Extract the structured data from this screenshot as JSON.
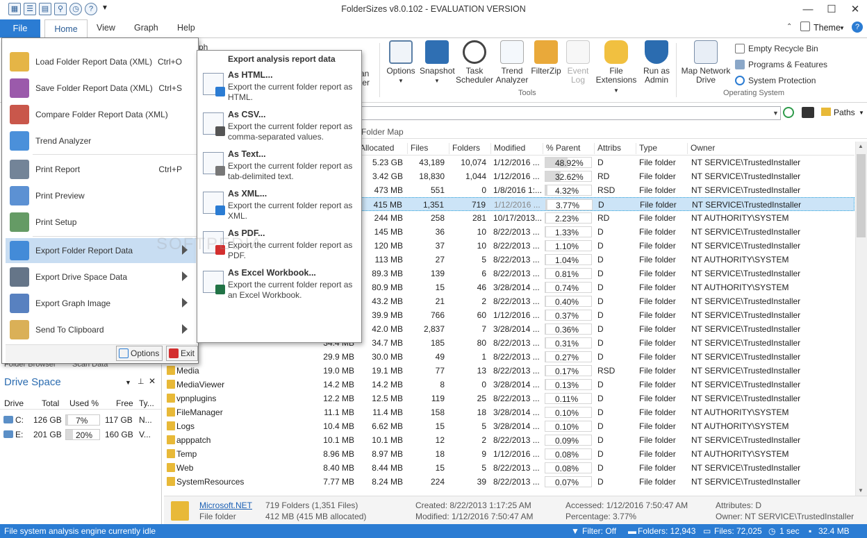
{
  "window": {
    "title": "FolderSizes v8.0.102 - EVALUATION VERSION",
    "minimize": "—",
    "maximize": "☐",
    "close": "✕"
  },
  "qat_icons": [
    "save-icon",
    "report-icon",
    "grid-icon",
    "filter-icon",
    "clock-icon",
    "help-icon"
  ],
  "tabs": {
    "file": "File",
    "home": "Home",
    "view": "View",
    "graph": "Graph",
    "help": "Help",
    "theme": "Theme"
  },
  "ribbon": {
    "partial_view": "ph",
    "partial_filter_a": "an",
    "partial_filter_b": "ter",
    "options": "Options",
    "snapshot": "Snapshot",
    "task_scheduler_1": "Task",
    "task_scheduler_2": "Scheduler",
    "trend_1": "Trend",
    "trend_2": "Analyzer",
    "filterzip": "FilterZip",
    "event_1": "Event",
    "event_2": "Log",
    "file_ext_1": "File",
    "file_ext_2": "Extensions",
    "run_admin_1": "Run as",
    "run_admin_2": "Admin",
    "tools_group": "Tools",
    "map_network_1": "Map Network",
    "map_network_2": "Drive",
    "empty_recycle": "Empty Recycle Bin",
    "programs": "Programs & Features",
    "system_protection": "System Protection",
    "os_group": "Operating System"
  },
  "pathbar": {
    "paths_label": "Paths"
  },
  "view_tabs": {
    "folder_map": "Folder Map"
  },
  "columns": [
    "Allocated",
    "Files",
    "Folders",
    "Modified",
    "% Parent",
    "Attribs",
    "Type",
    "Owner"
  ],
  "rows": [
    {
      "name": "",
      "size": "",
      "alloc": "5.23 GB",
      "files": "43,189",
      "folders": "10,074",
      "mod": "1/12/2016 ...",
      "pct": "48.92%",
      "pctv": 48.92,
      "attr": "D",
      "type": "File folder",
      "owner": "NT SERVICE\\TrustedInstaller"
    },
    {
      "name": "",
      "size": "",
      "alloc": "3.42 GB",
      "files": "18,830",
      "folders": "1,044",
      "mod": "1/12/2016 ...",
      "pct": "32.62%",
      "pctv": 32.62,
      "attr": "RD",
      "type": "File folder",
      "owner": "NT SERVICE\\TrustedInstaller"
    },
    {
      "name": "",
      "size": "",
      "alloc": "473 MB",
      "files": "551",
      "folders": "0",
      "mod": "1/8/2016 1:...",
      "pct": "4.32%",
      "pctv": 4.32,
      "attr": "RSD",
      "type": "File folder",
      "owner": "NT SERVICE\\TrustedInstaller"
    },
    {
      "name": "",
      "size": "",
      "alloc": "415 MB",
      "files": "1,351",
      "folders": "719",
      "mod": "1/12/2016 ...",
      "pct": "3.77%",
      "pctv": 3.77,
      "attr": "D",
      "type": "File folder",
      "owner": "NT SERVICE\\TrustedInstaller"
    },
    {
      "name": "",
      "size": "",
      "alloc": "244 MB",
      "files": "258",
      "folders": "281",
      "mod": "10/17/2013...",
      "pct": "2.23%",
      "pctv": 2.23,
      "attr": "RD",
      "type": "File folder",
      "owner": "NT AUTHORITY\\SYSTEM"
    },
    {
      "name": "",
      "size": "",
      "alloc": "145 MB",
      "files": "36",
      "folders": "10",
      "mod": "8/22/2013 ...",
      "pct": "1.33%",
      "pctv": 1.33,
      "attr": "D",
      "type": "File folder",
      "owner": "NT SERVICE\\TrustedInstaller"
    },
    {
      "name": "",
      "size": "",
      "alloc": "120 MB",
      "files": "37",
      "folders": "10",
      "mod": "8/22/2013 ...",
      "pct": "1.10%",
      "pctv": 1.1,
      "attr": "D",
      "type": "File folder",
      "owner": "NT SERVICE\\TrustedInstaller"
    },
    {
      "name": "",
      "size": "",
      "alloc": "113 MB",
      "files": "27",
      "folders": "5",
      "mod": "8/22/2013 ...",
      "pct": "1.04%",
      "pctv": 1.04,
      "attr": "D",
      "type": "File folder",
      "owner": "NT AUTHORITY\\SYSTEM"
    },
    {
      "name": "",
      "size": "",
      "alloc": "89.3 MB",
      "files": "139",
      "folders": "6",
      "mod": "8/22/2013 ...",
      "pct": "0.81%",
      "pctv": 0.81,
      "attr": "D",
      "type": "File folder",
      "owner": "NT SERVICE\\TrustedInstaller"
    },
    {
      "name": "",
      "size": "",
      "alloc": "80.9 MB",
      "files": "15",
      "folders": "46",
      "mod": "3/28/2014 ...",
      "pct": "0.74%",
      "pctv": 0.74,
      "attr": "D",
      "type": "File folder",
      "owner": "NT AUTHORITY\\SYSTEM"
    },
    {
      "name": "",
      "size": "",
      "alloc": "43.2 MB",
      "files": "21",
      "folders": "2",
      "mod": "8/22/2013 ...",
      "pct": "0.40%",
      "pctv": 0.4,
      "attr": "D",
      "type": "File folder",
      "owner": "NT SERVICE\\TrustedInstaller"
    },
    {
      "name": "",
      "size": "",
      "alloc": "39.9 MB",
      "files": "766",
      "folders": "60",
      "mod": "1/12/2016 ...",
      "pct": "0.37%",
      "pctv": 0.37,
      "attr": "D",
      "type": "File folder",
      "owner": "NT SERVICE\\TrustedInstaller"
    },
    {
      "name": "",
      "size": "",
      "alloc": "42.0 MB",
      "files": "2,837",
      "folders": "7",
      "mod": "3/28/2014 ...",
      "pct": "0.36%",
      "pctv": 0.36,
      "attr": "D",
      "type": "File folder",
      "owner": "NT SERVICE\\TrustedInstaller"
    },
    {
      "name": "",
      "size": "34.4 MB",
      "alloc": "34.7 MB",
      "files": "185",
      "folders": "80",
      "mod": "8/22/2013 ...",
      "pct": "0.31%",
      "pctv": 0.31,
      "attr": "D",
      "type": "File folder",
      "owner": "NT SERVICE\\TrustedInstaller"
    },
    {
      "name": "",
      "size": "29.9 MB",
      "alloc": "30.0 MB",
      "files": "49",
      "folders": "1",
      "mod": "8/22/2013 ...",
      "pct": "0.27%",
      "pctv": 0.27,
      "attr": "D",
      "type": "File folder",
      "owner": "NT SERVICE\\TrustedInstaller"
    },
    {
      "name": "Media",
      "size": "19.0 MB",
      "alloc": "19.1 MB",
      "files": "77",
      "folders": "13",
      "mod": "8/22/2013 ...",
      "pct": "0.17%",
      "pctv": 0.17,
      "attr": "RSD",
      "type": "File folder",
      "owner": "NT SERVICE\\TrustedInstaller"
    },
    {
      "name": "MediaViewer",
      "size": "14.2 MB",
      "alloc": "14.2 MB",
      "files": "8",
      "folders": "0",
      "mod": "3/28/2014 ...",
      "pct": "0.13%",
      "pctv": 0.13,
      "attr": "D",
      "type": "File folder",
      "owner": "NT SERVICE\\TrustedInstaller"
    },
    {
      "name": "vpnplugins",
      "size": "12.2 MB",
      "alloc": "12.5 MB",
      "files": "119",
      "folders": "25",
      "mod": "8/22/2013 ...",
      "pct": "0.11%",
      "pctv": 0.11,
      "attr": "D",
      "type": "File folder",
      "owner": "NT SERVICE\\TrustedInstaller"
    },
    {
      "name": "FileManager",
      "size": "11.1 MB",
      "alloc": "11.4 MB",
      "files": "158",
      "folders": "18",
      "mod": "3/28/2014 ...",
      "pct": "0.10%",
      "pctv": 0.1,
      "attr": "D",
      "type": "File folder",
      "owner": "NT AUTHORITY\\SYSTEM"
    },
    {
      "name": "Logs",
      "size": "10.4 MB",
      "alloc": "6.62 MB",
      "files": "15",
      "folders": "5",
      "mod": "3/28/2014 ...",
      "pct": "0.10%",
      "pctv": 0.1,
      "attr": "D",
      "type": "File folder",
      "owner": "NT AUTHORITY\\SYSTEM"
    },
    {
      "name": "apppatch",
      "size": "10.1 MB",
      "alloc": "10.1 MB",
      "files": "12",
      "folders": "2",
      "mod": "8/22/2013 ...",
      "pct": "0.09%",
      "pctv": 0.09,
      "attr": "D",
      "type": "File folder",
      "owner": "NT SERVICE\\TrustedInstaller"
    },
    {
      "name": "Temp",
      "size": "8.96 MB",
      "alloc": "8.97 MB",
      "files": "18",
      "folders": "9",
      "mod": "1/12/2016 ...",
      "pct": "0.08%",
      "pctv": 0.08,
      "attr": "D",
      "type": "File folder",
      "owner": "NT AUTHORITY\\SYSTEM"
    },
    {
      "name": "Web",
      "size": "8.40 MB",
      "alloc": "8.44 MB",
      "files": "15",
      "folders": "5",
      "mod": "8/22/2013 ...",
      "pct": "0.08%",
      "pctv": 0.08,
      "attr": "D",
      "type": "File folder",
      "owner": "NT SERVICE\\TrustedInstaller"
    },
    {
      "name": "SystemResources",
      "size": "7.77 MB",
      "alloc": "8.24 MB",
      "files": "224",
      "folders": "39",
      "mod": "8/22/2013 ...",
      "pct": "0.07%",
      "pctv": 0.07,
      "attr": "D",
      "type": "File folder",
      "owner": "NT SERVICE\\TrustedInstaller"
    }
  ],
  "left_pane": {
    "tab_a": "Folder Browser",
    "tab_b": "Scan Data",
    "title": "Drive Space",
    "columns": [
      "Drive",
      "Total",
      "Used %",
      "Free",
      "Ty..."
    ],
    "drives": [
      {
        "drive": "C:",
        "total": "126 GB",
        "used": "7%",
        "usedv": 7,
        "free": "117 GB",
        "type": "N..."
      },
      {
        "drive": "E:",
        "total": "201 GB",
        "used": "20%",
        "usedv": 20,
        "free": "160 GB",
        "type": "V..."
      }
    ]
  },
  "file_menu": {
    "items": [
      {
        "label": "Load Folder Report Data (XML)",
        "shortcut": "Ctrl+O",
        "icon": "load-report-icon",
        "color": "#e0a826"
      },
      {
        "label": "Save Folder Report Data (XML)",
        "shortcut": "Ctrl+S",
        "icon": "save-report-icon",
        "color": "#8a3d9c"
      },
      {
        "label": "Compare Folder Report Data (XML)",
        "shortcut": "",
        "icon": "compare-report-icon",
        "color": "#c0392b"
      },
      {
        "label": "Trend Analyzer",
        "shortcut": "",
        "icon": "trend-icon",
        "color": "#2b7cd3"
      },
      {
        "label": "Print Report",
        "shortcut": "Ctrl+P",
        "icon": "print-icon",
        "color": "#5b6f86"
      },
      {
        "label": "Print Preview",
        "shortcut": "",
        "icon": "print-preview-icon",
        "color": "#3f7ecb"
      },
      {
        "label": "Print Setup",
        "shortcut": "",
        "icon": "print-setup-icon",
        "color": "#4a8a4a"
      },
      {
        "label": "Export Folder Report Data",
        "shortcut": "",
        "icon": "export-report-icon",
        "color": "#2b7cd3",
        "submenu": true
      },
      {
        "label": "Export Drive Space Data",
        "shortcut": "",
        "icon": "export-drive-icon",
        "color": "#4a5d73",
        "submenu": true
      },
      {
        "label": "Export Graph Image",
        "shortcut": "",
        "icon": "export-graph-icon",
        "color": "#3b6bb5",
        "submenu": true
      },
      {
        "label": "Send To Clipboard",
        "shortcut": "",
        "icon": "clipboard-icon",
        "color": "#d4a23a",
        "submenu": true
      }
    ],
    "options": "Options",
    "exit": "Exit"
  },
  "submenu": {
    "header": "Export analysis report data",
    "items": [
      {
        "title": "As HTML...",
        "desc": "Export the current folder report as HTML.",
        "icon": "html-export-icon",
        "color": "#2b7cd3"
      },
      {
        "title": "As CSV...",
        "desc": "Export the current folder report as comma-separated values.",
        "icon": "csv-export-icon",
        "color": "#555"
      },
      {
        "title": "As Text...",
        "desc": "Export the current folder report as tab-delimited text.",
        "icon": "text-export-icon",
        "color": "#777"
      },
      {
        "title": "As XML...",
        "desc": "Export the current folder report as XML.",
        "icon": "xml-export-icon",
        "color": "#2b7cd3"
      },
      {
        "title": "As PDF...",
        "desc": "Export the current folder report as PDF.",
        "icon": "pdf-export-icon",
        "color": "#d32f2f"
      },
      {
        "title": "As Excel Workbook...",
        "desc": "Export the current folder report as an Excel Workbook.",
        "icon": "excel-export-icon",
        "color": "#217346"
      }
    ]
  },
  "watermark": "SOFTPEDIA",
  "bottom_info": {
    "name": "Microsoft.NET",
    "type": "File folder",
    "counts": "719 Folders (1,351 Files)",
    "size": "412 MB (415 MB allocated)",
    "created": "Created: 8/22/2013 1:17:25 AM",
    "modified": "Modified: 1/12/2016 7:50:47 AM",
    "accessed": "Accessed: 1/12/2016 7:50:47 AM",
    "percentage": "Percentage: 3.77%",
    "attributes": "Attributes: D",
    "owner": "Owner: NT SERVICE\\TrustedInstaller"
  },
  "status": {
    "text": "File system analysis engine currently idle",
    "filter": "Filter: Off",
    "folders": "Folders: 12,943",
    "files": "Files: 72,025",
    "time": "1 sec",
    "memory": "32.4 MB"
  }
}
